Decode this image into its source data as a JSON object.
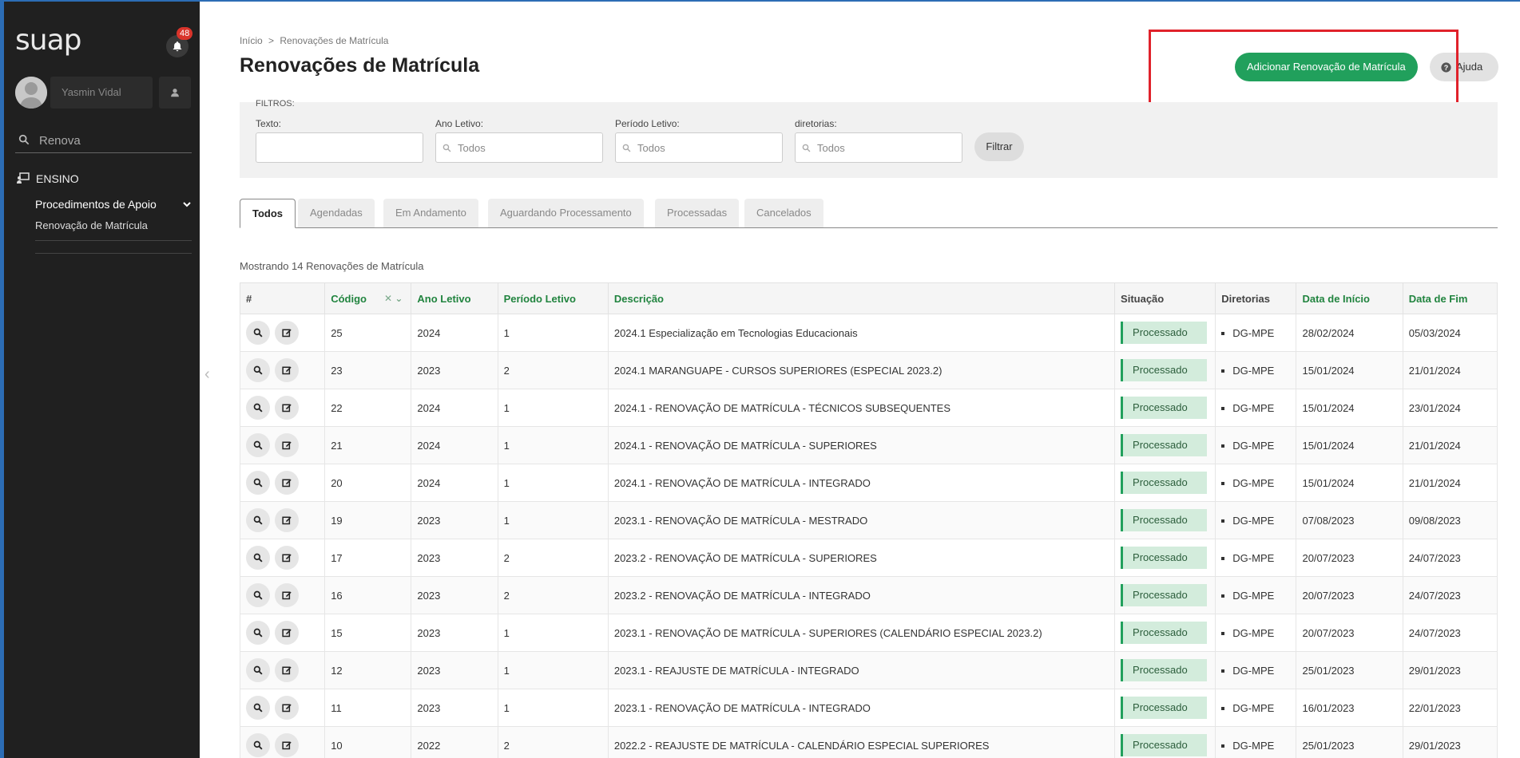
{
  "app": {
    "logo": "suap",
    "notifications": "48"
  },
  "user": {
    "name": "Yasmin Vidal"
  },
  "sidebar_search": {
    "value": "Renova"
  },
  "menu": {
    "section": "ENSINO",
    "submenu_title": "Procedimentos de Apoio",
    "submenu_item": "Renovação de Matrícula"
  },
  "breadcrumb": {
    "home": "Início",
    "separator": ">",
    "current": "Renovações de Matrícula"
  },
  "page_title": "Renovações de Matrícula",
  "actions": {
    "add_label": "Adicionar Renovação de Matrícula",
    "help_label": "Ajuda"
  },
  "filters": {
    "legend": "FILTROS:",
    "texto_label": "Texto:",
    "texto_value": "",
    "ano_label": "Ano Letivo:",
    "ano_value": "Todos",
    "periodo_label": "Período Letivo:",
    "periodo_value": "Todos",
    "diretorias_label": "diretorias:",
    "diretorias_value": "Todos",
    "filter_button": "Filtrar"
  },
  "tabs": [
    "Todos",
    "Agendadas",
    "Em Andamento",
    "Aguardando Processamento",
    "Processadas",
    "Cancelados"
  ],
  "count_text": "Mostrando 14 Renovações de Matrícula",
  "table": {
    "headers": [
      "#",
      "Código",
      "Ano Letivo",
      "Período Letivo",
      "Descrição",
      "Situação",
      "Diretorias",
      "Data de Início",
      "Data de Fim"
    ],
    "rows": [
      {
        "codigo": "25",
        "ano": "2024",
        "periodo": "1",
        "descricao": "2024.1 Especialização em Tecnologias Educacionais",
        "situacao": "Processado",
        "diretoria": "DG-MPE",
        "inicio": "28/02/2024",
        "fim": "05/03/2024"
      },
      {
        "codigo": "23",
        "ano": "2023",
        "periodo": "2",
        "descricao": "2024.1 MARANGUAPE - CURSOS SUPERIORES (ESPECIAL 2023.2)",
        "situacao": "Processado",
        "diretoria": "DG-MPE",
        "inicio": "15/01/2024",
        "fim": "21/01/2024"
      },
      {
        "codigo": "22",
        "ano": "2024",
        "periodo": "1",
        "descricao": "2024.1 - RENOVAÇÃO DE MATRÍCULA - TÉCNICOS SUBSEQUENTES",
        "situacao": "Processado",
        "diretoria": "DG-MPE",
        "inicio": "15/01/2024",
        "fim": "23/01/2024"
      },
      {
        "codigo": "21",
        "ano": "2024",
        "periodo": "1",
        "descricao": "2024.1 - RENOVAÇÃO DE MATRÍCULA - SUPERIORES",
        "situacao": "Processado",
        "diretoria": "DG-MPE",
        "inicio": "15/01/2024",
        "fim": "21/01/2024"
      },
      {
        "codigo": "20",
        "ano": "2024",
        "periodo": "1",
        "descricao": "2024.1 - RENOVAÇÃO DE MATRÍCULA - INTEGRADO",
        "situacao": "Processado",
        "diretoria": "DG-MPE",
        "inicio": "15/01/2024",
        "fim": "21/01/2024"
      },
      {
        "codigo": "19",
        "ano": "2023",
        "periodo": "1",
        "descricao": "2023.1 - RENOVAÇÃO DE MATRÍCULA - MESTRADO",
        "situacao": "Processado",
        "diretoria": "DG-MPE",
        "inicio": "07/08/2023",
        "fim": "09/08/2023"
      },
      {
        "codigo": "17",
        "ano": "2023",
        "periodo": "2",
        "descricao": "2023.2 - RENOVAÇÃO DE MATRÍCULA - SUPERIORES",
        "situacao": "Processado",
        "diretoria": "DG-MPE",
        "inicio": "20/07/2023",
        "fim": "24/07/2023"
      },
      {
        "codigo": "16",
        "ano": "2023",
        "periodo": "2",
        "descricao": "2023.2 - RENOVAÇÃO DE MATRÍCULA - INTEGRADO",
        "situacao": "Processado",
        "diretoria": "DG-MPE",
        "inicio": "20/07/2023",
        "fim": "24/07/2023"
      },
      {
        "codigo": "15",
        "ano": "2023",
        "periodo": "1",
        "descricao": "2023.1 - RENOVAÇÃO DE MATRÍCULA - SUPERIORES (CALENDÁRIO ESPECIAL 2023.2)",
        "situacao": "Processado",
        "diretoria": "DG-MPE",
        "inicio": "20/07/2023",
        "fim": "24/07/2023"
      },
      {
        "codigo": "12",
        "ano": "2023",
        "periodo": "1",
        "descricao": "2023.1 - REAJUSTE DE MATRÍCULA - INTEGRADO",
        "situacao": "Processado",
        "diretoria": "DG-MPE",
        "inicio": "25/01/2023",
        "fim": "29/01/2023"
      },
      {
        "codigo": "11",
        "ano": "2023",
        "periodo": "1",
        "descricao": "2023.1 - RENOVAÇÃO DE MATRÍCULA - INTEGRADO",
        "situacao": "Processado",
        "diretoria": "DG-MPE",
        "inicio": "16/01/2023",
        "fim": "22/01/2023"
      },
      {
        "codigo": "10",
        "ano": "2022",
        "periodo": "2",
        "descricao": "2022.2 - REAJUSTE DE MATRÍCULA - CALENDÁRIO ESPECIAL SUPERIORES",
        "situacao": "Processado",
        "diretoria": "DG-MPE",
        "inicio": "25/01/2023",
        "fim": "29/01/2023"
      }
    ]
  },
  "colors": {
    "brand_green": "#21a05c",
    "header_green": "#21843f",
    "sidebar_bg": "#202020",
    "highlight_red": "#e0222b"
  }
}
